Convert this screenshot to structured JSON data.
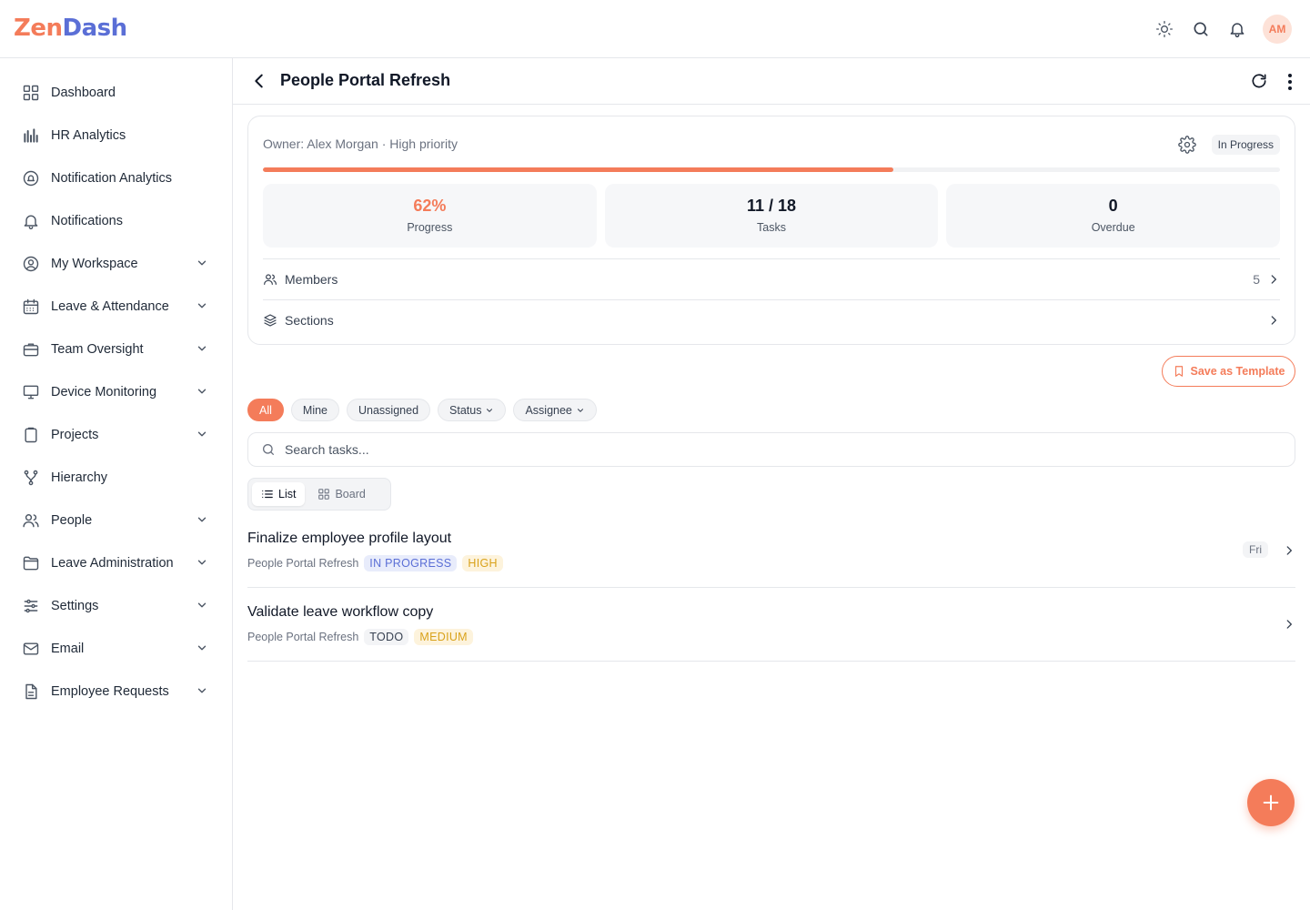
{
  "app": {
    "logo_part1": "Zen",
    "logo_part2": "Dash",
    "avatar_initials": "AM",
    "colors": {
      "accent": "#f47c5a",
      "brand_blue": "#5b6fd6"
    }
  },
  "header_icons": [
    "sun-icon",
    "search-icon",
    "bell-icon"
  ],
  "sidebar": {
    "items": [
      {
        "label": "Dashboard",
        "icon": "grid-icon",
        "expandable": false
      },
      {
        "label": "HR Analytics",
        "icon": "bar-chart-icon",
        "expandable": false
      },
      {
        "label": "Notification Analytics",
        "icon": "bell-circle-icon",
        "expandable": false
      },
      {
        "label": "Notifications",
        "icon": "bell-icon",
        "expandable": false
      },
      {
        "label": "My Workspace",
        "icon": "user-circle-icon",
        "expandable": true
      },
      {
        "label": "Leave & Attendance",
        "icon": "calendar-icon",
        "expandable": true
      },
      {
        "label": "Team Oversight",
        "icon": "briefcase-icon",
        "expandable": true
      },
      {
        "label": "Device Monitoring",
        "icon": "monitor-icon",
        "expandable": true
      },
      {
        "label": "Projects",
        "icon": "clipboard-icon",
        "expandable": true
      },
      {
        "label": "Hierarchy",
        "icon": "hierarchy-icon",
        "expandable": false
      },
      {
        "label": "People",
        "icon": "people-icon",
        "expandable": true
      },
      {
        "label": "Leave Administration",
        "icon": "folder-icon",
        "expandable": true
      },
      {
        "label": "Settings",
        "icon": "sliders-icon",
        "expandable": true
      },
      {
        "label": "Email",
        "icon": "mail-icon",
        "expandable": true
      },
      {
        "label": "Employee Requests",
        "icon": "document-icon",
        "expandable": true
      }
    ]
  },
  "page": {
    "title": "People Portal Refresh",
    "owner_line": "Owner: Alex Morgan · High priority",
    "status": "In Progress",
    "progress_fraction": 0.62,
    "stats": [
      {
        "value": "62%",
        "label": "Progress"
      },
      {
        "value": "11 / 18",
        "label": "Tasks"
      },
      {
        "value": "0",
        "label": "Overdue"
      }
    ],
    "members_label": "Members",
    "members_count": "5",
    "sections_label": "Sections",
    "save_template_label": "Save as Template"
  },
  "filters": {
    "chips": [
      "All",
      "Mine",
      "Unassigned"
    ],
    "status_label": "Status",
    "assignee_label": "Assignee",
    "active": "All"
  },
  "search": {
    "placeholder": "Search tasks..."
  },
  "view_toggle": {
    "list_label": "List",
    "board_label": "Board",
    "active": "List"
  },
  "tasks": [
    {
      "title": "Finalize employee profile layout",
      "project": "People Portal Refresh",
      "status": "IN PROGRESS",
      "priority": "HIGH",
      "due": "Fri"
    },
    {
      "title": "Validate leave workflow copy",
      "project": "People Portal Refresh",
      "status": "TODO",
      "priority": "MEDIUM",
      "due": ""
    }
  ]
}
